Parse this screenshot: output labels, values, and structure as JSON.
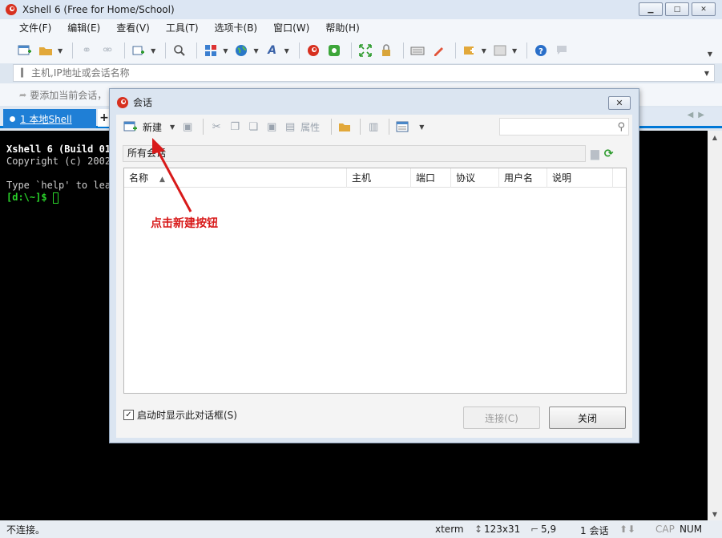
{
  "window": {
    "title": "Xshell 6 (Free for Home/School)",
    "minimize": "▁",
    "maximize": "□",
    "close": "✕"
  },
  "menu": [
    "文件(F)",
    "编辑(E)",
    "查看(V)",
    "工具(T)",
    "选项卡(B)",
    "窗口(W)",
    "帮助(H)"
  ],
  "toolbar_icons": [
    "new-session-icon",
    "open-folder-icon",
    "link-icon",
    "unlink-icon",
    "new-window-icon",
    "search-icon",
    "layout-icon",
    "globe-icon",
    "font-icon",
    "xshell-icon",
    "xftp-icon",
    "fullscreen-icon",
    "lock-icon",
    "keyboard-icon",
    "pen-icon",
    "new-tab-icon",
    "window-icon",
    "help-icon",
    "chat-icon"
  ],
  "address": {
    "placeholder": "主机,IP地址或会话名称"
  },
  "hint": {
    "text": "要添加当前会话，"
  },
  "tabs": {
    "active_label": "1 本地Shell",
    "add": "+"
  },
  "terminal": {
    "line1": "Xshell 6 (Build 01",
    "line2": "Copyright (c) 2002",
    "line3": "Type `help' to lea",
    "prompt": "[d:\\~]$ "
  },
  "status": {
    "left": "不连接。",
    "term": "xterm",
    "size": "123x31",
    "pos": "5,9",
    "sessions": "1 会话",
    "cap": "CAP",
    "num": "NUM"
  },
  "dialog": {
    "title": "会话",
    "close": "✕",
    "new_label": "新建",
    "properties_label": "属性",
    "path": "所有会话",
    "columns": [
      "名称",
      "主机",
      "端口",
      "协议",
      "用户名",
      "说明"
    ],
    "annotation": "点击新建按钮",
    "checkbox_label": "启动时显示此对话框(S)",
    "checkbox_checked": "✓",
    "connect_label": "连接(C)",
    "close_label": "关闭"
  },
  "colors": {
    "tab_active": "#1f7fd6",
    "terminal_bg": "#000000",
    "prompt": "#2ad42a",
    "annotation": "#d81a1a"
  }
}
